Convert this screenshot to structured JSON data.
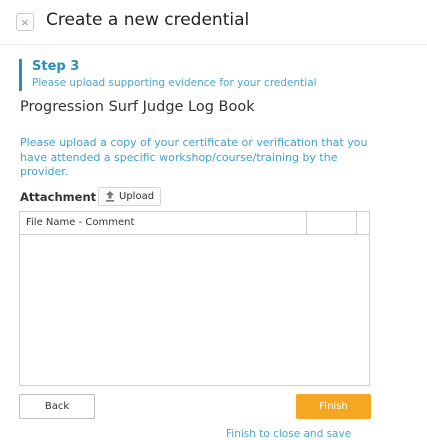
{
  "dialog": {
    "title": "Create a new credential",
    "close_symbol": "×"
  },
  "step": {
    "title": "Step 3",
    "subtitle": "Please upload supporting evidence for your credential"
  },
  "credential_name": "Progression Surf Judge Log Book",
  "instructions": "Please upload a copy of your certificate or verification that you have attended a specific workshop/course/training by the provider.",
  "attachment": {
    "label": "Attachment",
    "upload_label": "Upload"
  },
  "table": {
    "columns": [
      "File Name - Comment",
      "",
      ""
    ],
    "rows": []
  },
  "actions": {
    "back_label": "Back",
    "finish_label": "Finish",
    "finish_hint": "Finish to close and save"
  },
  "colors": {
    "accent": "#2a8fb8",
    "finish": "#f5a623"
  }
}
